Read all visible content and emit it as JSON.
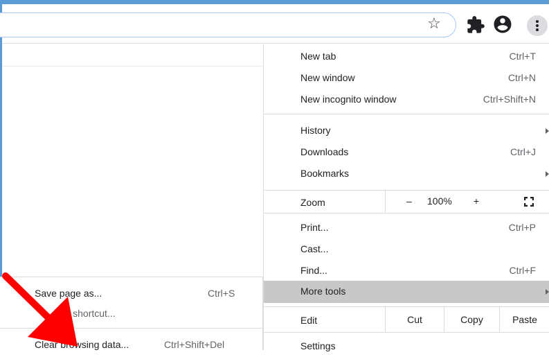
{
  "toolbar": {
    "icons": [
      "star-icon",
      "extensions-icon",
      "profile-icon",
      "menu-icon"
    ],
    "star_glyph": "☆",
    "accent": "#5b9bd5"
  },
  "menu": {
    "new_tab": {
      "label": "New tab",
      "shortcut": "Ctrl+T"
    },
    "new_window": {
      "label": "New window",
      "shortcut": "Ctrl+N"
    },
    "new_incognito": {
      "label": "New incognito window",
      "shortcut": "Ctrl+Shift+N"
    },
    "history": {
      "label": "History"
    },
    "downloads": {
      "label": "Downloads",
      "shortcut": "Ctrl+J"
    },
    "bookmarks": {
      "label": "Bookmarks"
    },
    "zoom": {
      "label": "Zoom",
      "minus": "–",
      "value": "100%",
      "plus": "+"
    },
    "print": {
      "label": "Print...",
      "shortcut": "Ctrl+P"
    },
    "cast": {
      "label": "Cast..."
    },
    "find": {
      "label": "Find...",
      "shortcut": "Ctrl+F"
    },
    "more_tools": {
      "label": "More tools"
    },
    "edit": {
      "label": "Edit",
      "cut": "Cut",
      "copy": "Copy",
      "paste": "Paste"
    },
    "settings": {
      "label": "Settings"
    }
  },
  "submenu": {
    "save_page": {
      "label": "Save page as...",
      "shortcut": "Ctrl+S"
    },
    "create_shortcut": {
      "label": "eate shortcut..."
    },
    "clear_browsing": {
      "label": "Clear browsing data...",
      "shortcut": "Ctrl+Shift+Del"
    }
  },
  "annotation": {
    "arrow_color": "#ff0000"
  }
}
